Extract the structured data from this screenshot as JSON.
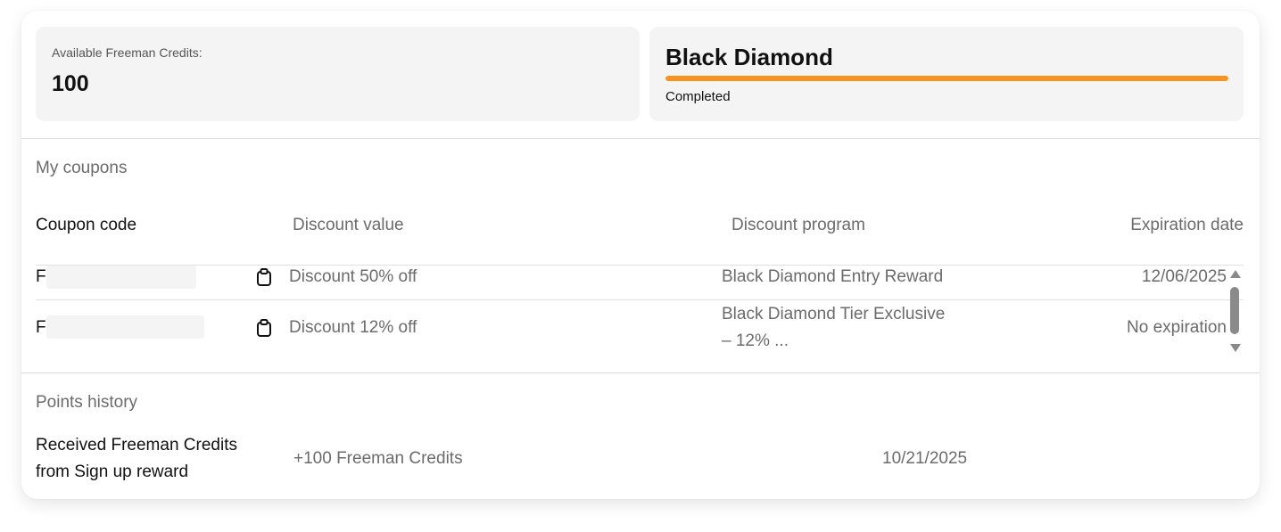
{
  "credits": {
    "label": "Available Freeman Credits:",
    "value": "100"
  },
  "tier": {
    "name": "Black Diamond",
    "progress": 1.0,
    "status": "Completed",
    "accent_color": "#f7931e"
  },
  "coupons": {
    "title": "My coupons",
    "columns": [
      "Coupon code",
      "Discount value",
      "Discount program",
      "Expiration date"
    ],
    "rows": [
      {
        "code_prefix": "F",
        "discount_value": "Discount 50% off",
        "program_line1": "Black Diamond Entry Reward",
        "program_line2": "",
        "expiration": "12/06/2025",
        "copy_icon": "clipboard-icon"
      },
      {
        "code_prefix": "F",
        "discount_value": "Discount 12% off",
        "program_line1": "Black Diamond Tier Exclusive",
        "program_line2": "– 12% ...",
        "expiration": "No expiration",
        "copy_icon": "clipboard-icon"
      }
    ]
  },
  "points_history": {
    "title": "Points history",
    "entries": [
      {
        "description_line1": "Received Freeman Credits",
        "description_line2": "from Sign up reward",
        "amount": "+100 Freeman Credits",
        "date": "10/21/2025"
      }
    ]
  }
}
